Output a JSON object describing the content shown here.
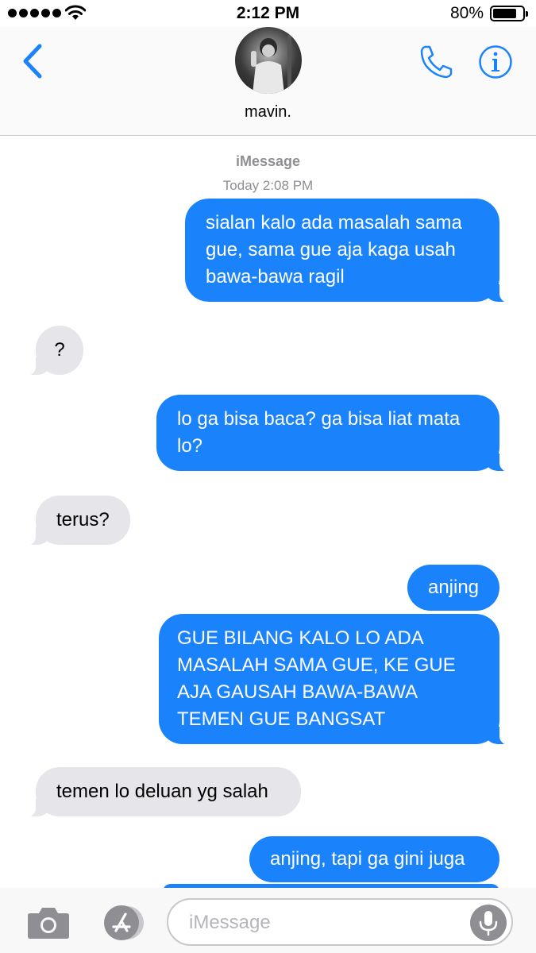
{
  "status_bar": {
    "time": "2:12 PM",
    "battery_percent_label": "80%",
    "battery_level": 0.8,
    "signal_dots": 5,
    "icons": [
      "signal-dots-icon",
      "wifi-icon",
      "battery-icon"
    ]
  },
  "header": {
    "contact_name": "mavin.",
    "icons": [
      "chevron-left-icon",
      "avatar",
      "phone-icon",
      "info-icon"
    ],
    "accent_color": "#1a82fb"
  },
  "conversation": {
    "service_label": "iMessage",
    "timestamp": "Today 2:08 PM",
    "messages": [
      {
        "direction": "outgoing",
        "text": "sialan kalo ada masalah sama gue, sama gue aja kaga usah bawa-bawa ragil"
      },
      {
        "direction": "incoming",
        "text": "?"
      },
      {
        "direction": "outgoing",
        "text": "lo ga bisa baca? ga bisa liat mata lo?"
      },
      {
        "direction": "incoming",
        "text": "terus?"
      },
      {
        "direction": "outgoing",
        "text": "anjing"
      },
      {
        "direction": "outgoing",
        "text": "GUE BILANG KALO LO ADA MASALAH SAMA GUE, KE GUE AJA GAUSAH BAWA-BAWA TEMEN GUE BANGSAT"
      },
      {
        "direction": "incoming",
        "text": "temen lo deluan yg salah"
      },
      {
        "direction": "outgoing",
        "text": "anjing, tapi ga gini juga"
      }
    ],
    "outgoing_color": "#1a82fb",
    "incoming_color": "#e5e5ea"
  },
  "input_bar": {
    "placeholder": "iMessage",
    "value": "",
    "icons": [
      "camera-icon",
      "app-store-icon",
      "microphone-icon"
    ]
  }
}
